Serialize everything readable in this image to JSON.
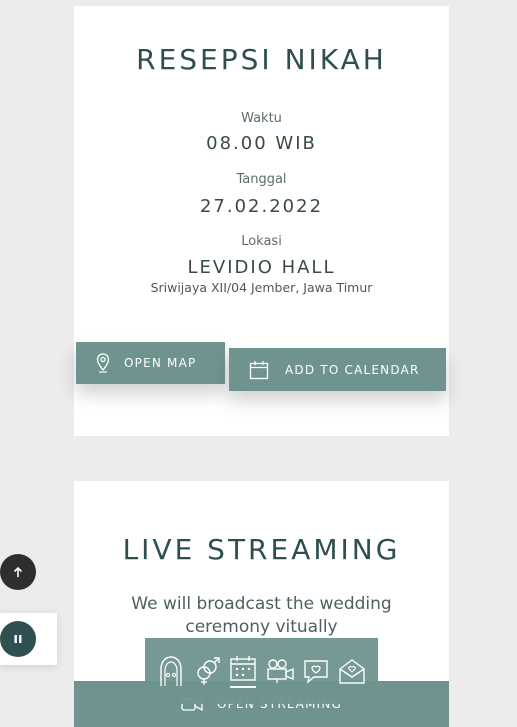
{
  "reception": {
    "title": "RESEPSI NIKAH",
    "time_label": "Waktu",
    "time_value": "08.00 WIB",
    "date_label": "Tanggal",
    "date_value": "27.02.2022",
    "location_label": "Lokasi",
    "location_name": "LEVIDIO HALL",
    "address": "Sriwijaya XII/04 Jember, Jawa Timur",
    "open_map_label": "OPEN MAP",
    "add_calendar_label": "ADD TO CALENDAR"
  },
  "live": {
    "title": "LIVE STREAMING",
    "description_line1": "We will broadcast the wedding",
    "description_line2": "ceremony vitually",
    "button_label": "OPEN STREAMING"
  },
  "floating": {
    "scroll_top_icon": "arrow-up-icon",
    "pause_icon": "pause-icon"
  },
  "bottom_nav": {
    "items": [
      "couple-arch-icon",
      "gender-symbols-icon",
      "calendar-icon",
      "video-camera-icon",
      "chat-heart-icon",
      "envelope-heart-icon"
    ],
    "active_index": 2
  },
  "colors": {
    "accent": "#6f9490",
    "title_text": "#2f4f4f",
    "background": "#ececed"
  }
}
